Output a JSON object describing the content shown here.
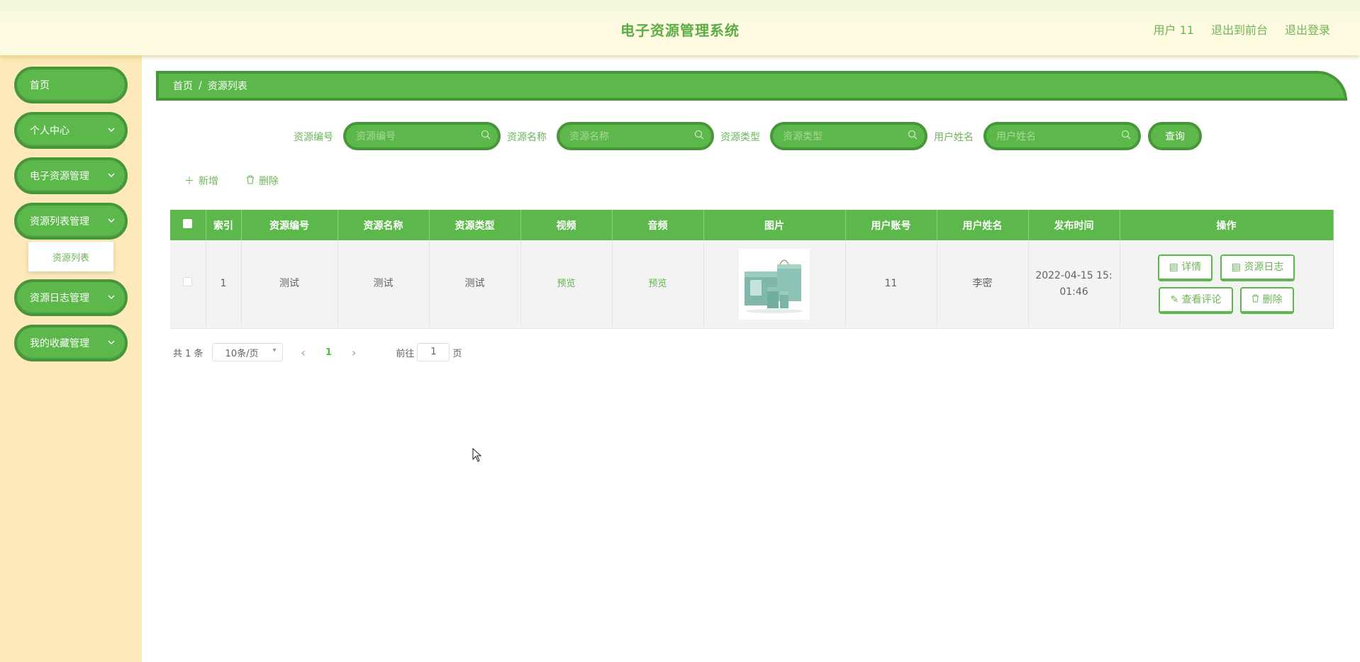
{
  "header": {
    "title": "电子资源管理系统",
    "user": "用户 11",
    "back_to_front": "退出到前台",
    "logout": "退出登录"
  },
  "sidebar": {
    "items": [
      {
        "label": "首页"
      },
      {
        "label": "个人中心"
      },
      {
        "label": "电子资源管理"
      },
      {
        "label": "资源列表管理"
      },
      {
        "label": "资源日志管理"
      },
      {
        "label": "我的收藏管理"
      }
    ],
    "submenu": {
      "label": "资源列表"
    }
  },
  "breadcrumb": {
    "home": "首页",
    "sep": "/",
    "current": "资源列表"
  },
  "search": {
    "fields": [
      {
        "label": "资源编号",
        "placeholder": "资源编号"
      },
      {
        "label": "资源名称",
        "placeholder": "资源名称"
      },
      {
        "label": "资源类型",
        "placeholder": "资源类型"
      },
      {
        "label": "用户姓名",
        "placeholder": "用户姓名"
      }
    ],
    "query_label": "查询"
  },
  "actions": {
    "add": "新增",
    "delete": "删除"
  },
  "table": {
    "headers": [
      "索引",
      "资源编号",
      "资源名称",
      "资源类型",
      "视频",
      "音频",
      "图片",
      "用户账号",
      "用户姓名",
      "发布时间",
      "操作"
    ],
    "rows": [
      {
        "index": "1",
        "code": "测试",
        "name": "测试",
        "type": "测试",
        "video": "预览",
        "audio": "预览",
        "account": "11",
        "username": "李密",
        "time_line1": "2022-04-15 15:",
        "time_line2": "01:46",
        "ops": {
          "detail": "详情",
          "log": "资源日志",
          "comment": "查看评论",
          "delete": "删除"
        }
      }
    ]
  },
  "pagination": {
    "total": "共 1 条",
    "page_size": "10条/页",
    "current": "1",
    "goto_prefix": "前往",
    "goto_value": "1",
    "goto_suffix": "页"
  }
}
